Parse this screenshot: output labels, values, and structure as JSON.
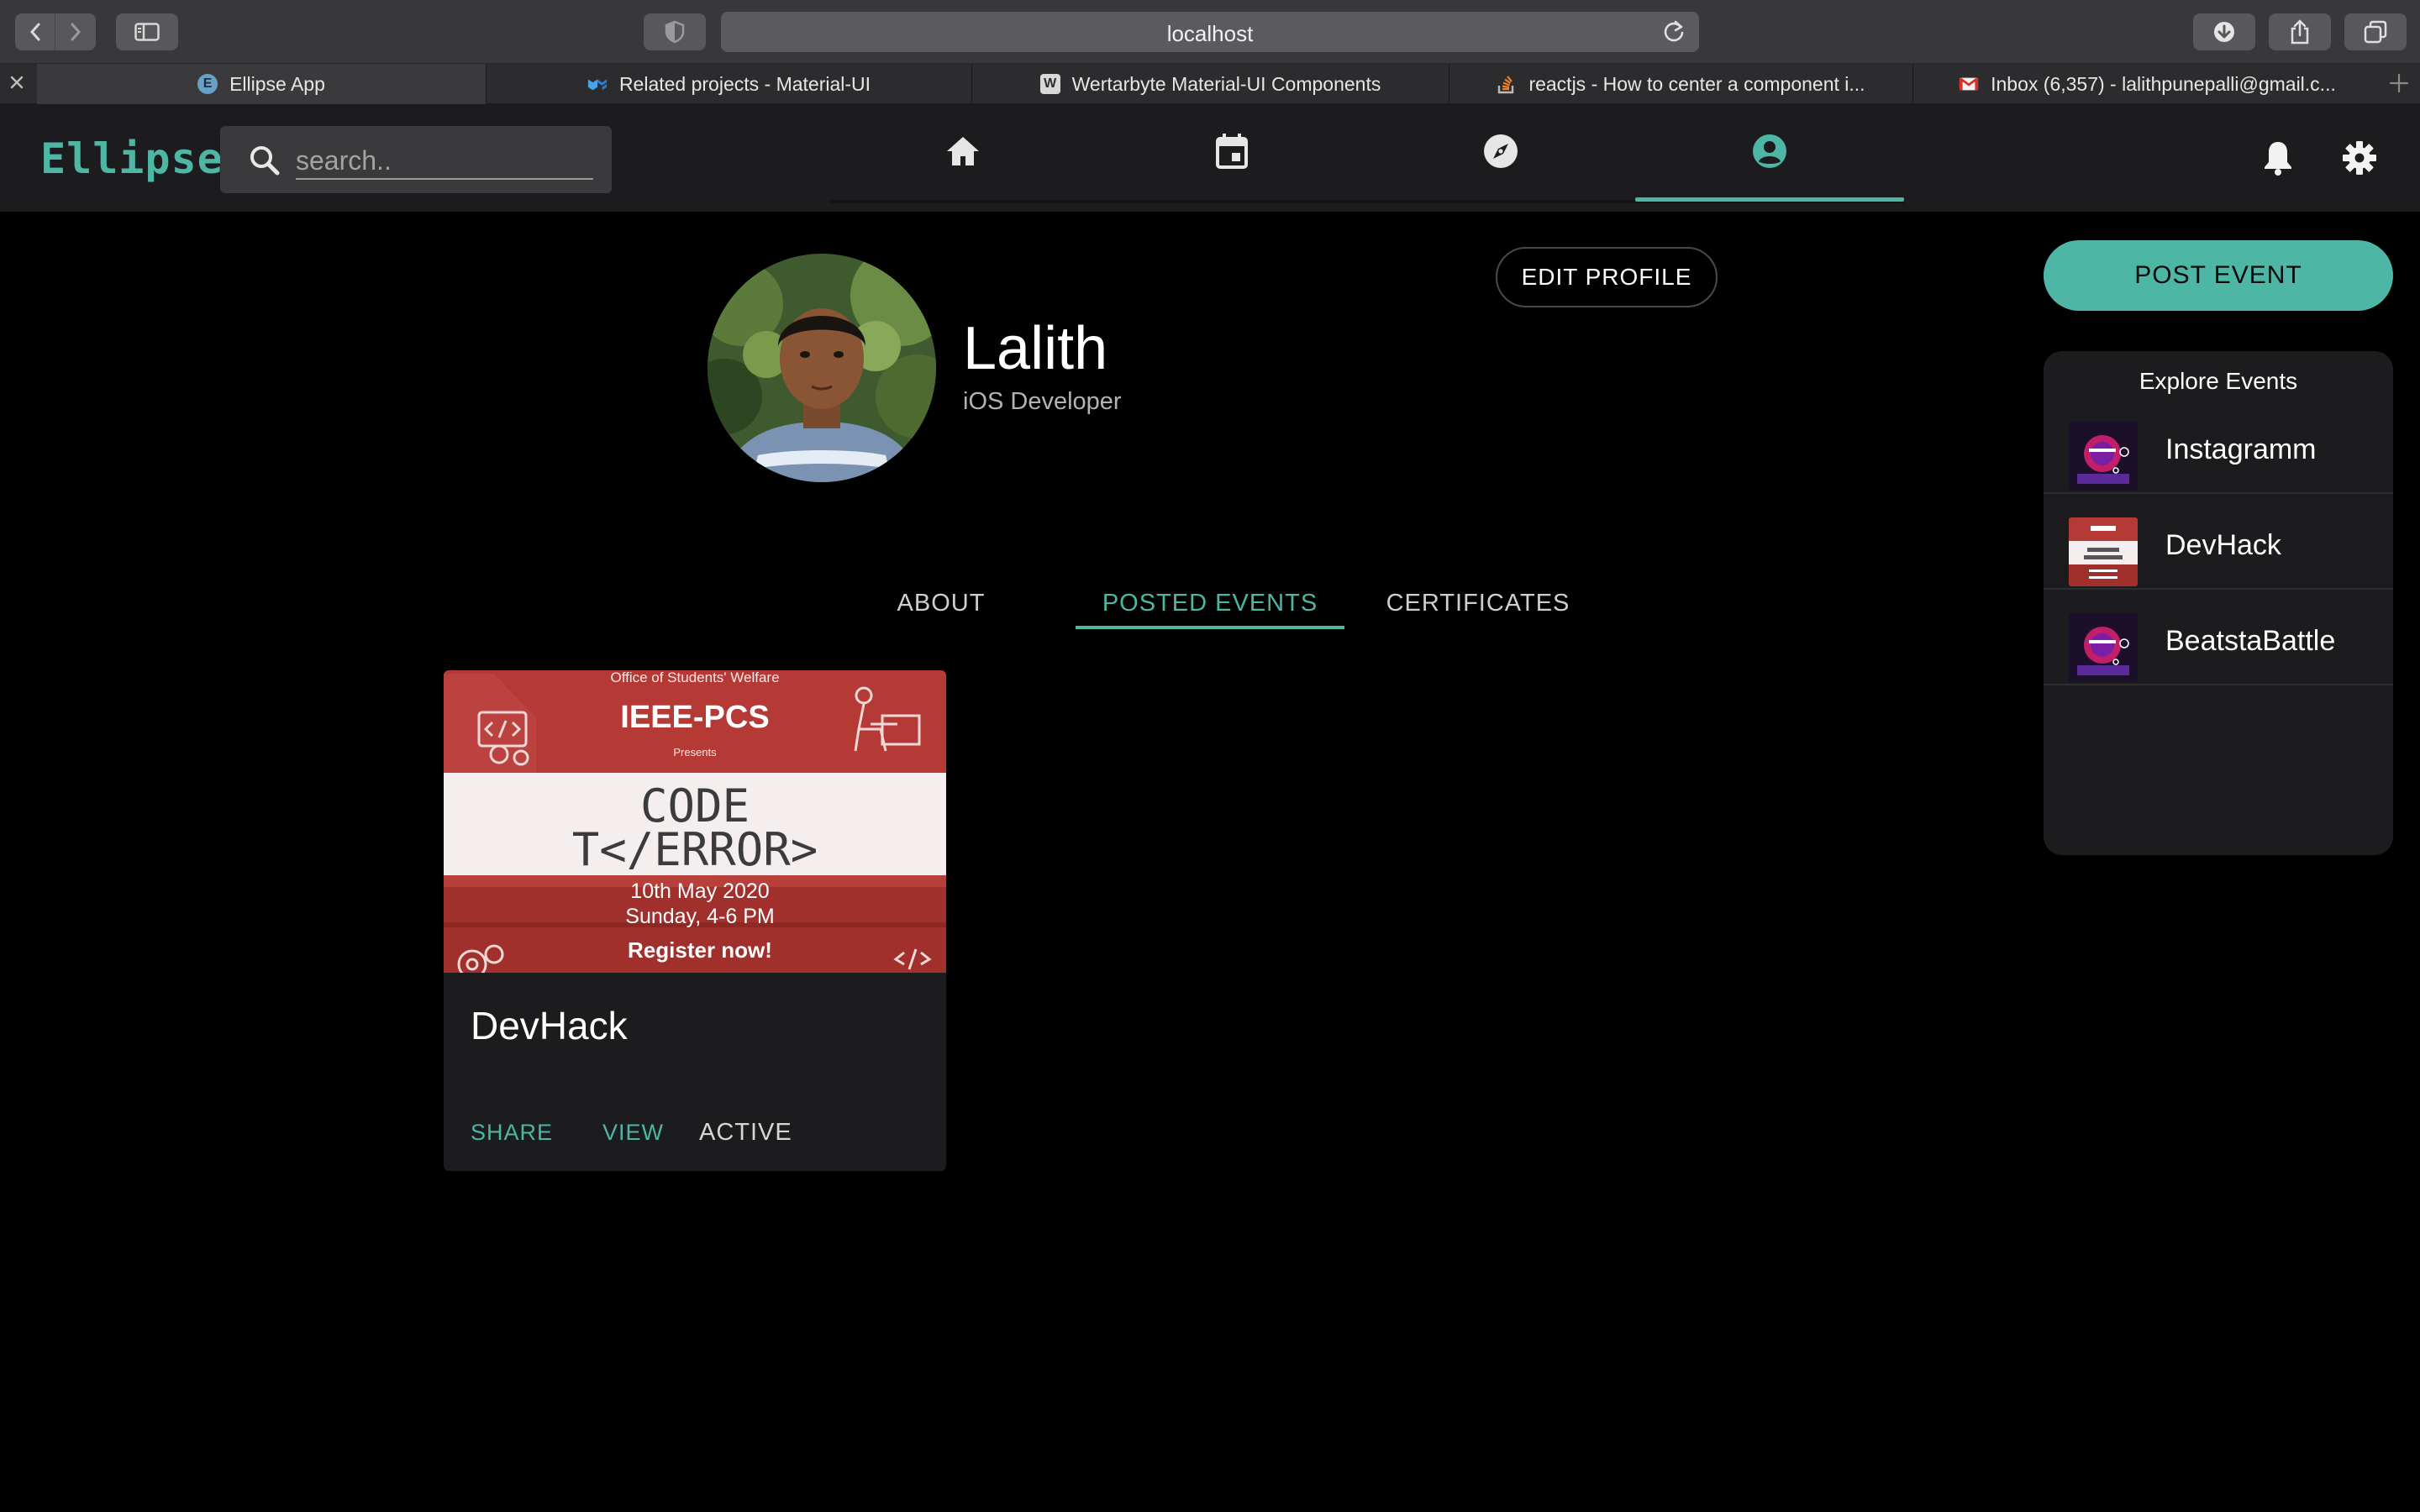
{
  "browser": {
    "url": "localhost",
    "tabs": [
      {
        "label": "Ellipse App",
        "favicon": "E",
        "active": true
      },
      {
        "label": "Related projects - Material-UI",
        "favicon": "mui"
      },
      {
        "label": "Wertarbyte Material-UI Components",
        "favicon": "W"
      },
      {
        "label": "reactjs - How to center a component i...",
        "favicon": "stackoverflow"
      },
      {
        "label": "Inbox (6,357) - lalithpunepalli@gmail.c...",
        "favicon": "gmail"
      }
    ]
  },
  "app": {
    "logo": "Ellipse",
    "search_placeholder": "search..",
    "nav": [
      {
        "name": "home-icon"
      },
      {
        "name": "calendar-icon"
      },
      {
        "name": "explore-icon"
      },
      {
        "name": "profile-icon",
        "active": true
      }
    ],
    "accent_color": "#4db6a4"
  },
  "profile": {
    "name": "Lalith",
    "role": "iOS Developer",
    "edit_label": "EDIT PROFILE",
    "tabs": [
      {
        "label": "ABOUT"
      },
      {
        "label": "POSTED EVENTS",
        "active": true
      },
      {
        "label": "CERTIFICATES"
      }
    ]
  },
  "event_card": {
    "poster": {
      "header": "Office of Students' Welfare",
      "org": "IEEE-PCS",
      "presents": "Presents",
      "title_line1": "CODE",
      "title_line2": "T</ERROR>",
      "date": "10th May 2020",
      "time": "Sunday, 4-6 PM",
      "cta": "Register now!"
    },
    "title": "DevHack",
    "share_label": "SHARE",
    "view_label": "VIEW",
    "status": "ACTIVE"
  },
  "sidebar": {
    "post_label": "POST EVENT",
    "explore_title": "Explore Events",
    "events": [
      {
        "label": "Instagramm"
      },
      {
        "label": "DevHack"
      },
      {
        "label": "BeatstaBattle"
      }
    ]
  }
}
